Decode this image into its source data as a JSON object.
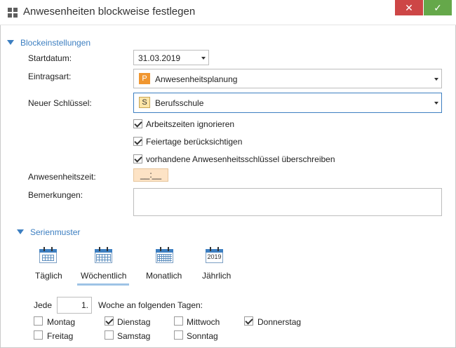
{
  "window": {
    "title": "Anwesenheiten blockweise festlegen",
    "close_glyph": "✕",
    "ok_glyph": "✓"
  },
  "block": {
    "header": "Blockeinstellungen",
    "start_label": "Startdatum:",
    "start_value": "31.03.2019",
    "type_label": "Eintragsart:",
    "type_badge": "P",
    "type_value": "Anwesenheitsplanung",
    "key_label": "Neuer Schlüssel:",
    "key_badge": "S",
    "key_value": "Berufsschule",
    "options": [
      {
        "label": "Arbeitszeiten ignorieren",
        "checked": true
      },
      {
        "label": "Feiertage berücksichtigen",
        "checked": true
      },
      {
        "label": "vorhandene Anwesenheitsschlüssel überschreiben",
        "checked": true
      }
    ],
    "time_label": "Anwesenheitszeit:",
    "time_value": "__:__",
    "remarks_label": "Bemerkungen:",
    "remarks_value": ""
  },
  "series": {
    "header": "Serienmuster",
    "tabs": [
      {
        "label": "Täglich",
        "icon": "calendar-day-icon"
      },
      {
        "label": "Wöchentlich",
        "icon": "calendar-week-icon",
        "selected": true
      },
      {
        "label": "Monatlich",
        "icon": "calendar-month-icon"
      },
      {
        "label": "Jährlich",
        "icon": "calendar-year-icon",
        "year": "2019"
      }
    ],
    "every_label": "Jede",
    "every_value": "1.",
    "week_label": "Woche an folgenden Tagen:",
    "days": [
      {
        "label": "Montag",
        "checked": false
      },
      {
        "label": "Dienstag",
        "checked": true
      },
      {
        "label": "Mittwoch",
        "checked": false
      },
      {
        "label": "Donnerstag",
        "checked": true
      },
      {
        "label": "Freitag",
        "checked": false
      },
      {
        "label": "Samstag",
        "checked": false
      },
      {
        "label": "Sonntag",
        "checked": false
      }
    ]
  },
  "colors": {
    "accent": "#3d7fc1",
    "close": "#cd4646",
    "ok": "#65a84a",
    "time_field": "#fde3c5",
    "badge_p": "#f0962f",
    "badge_s": "#fde5a6"
  }
}
